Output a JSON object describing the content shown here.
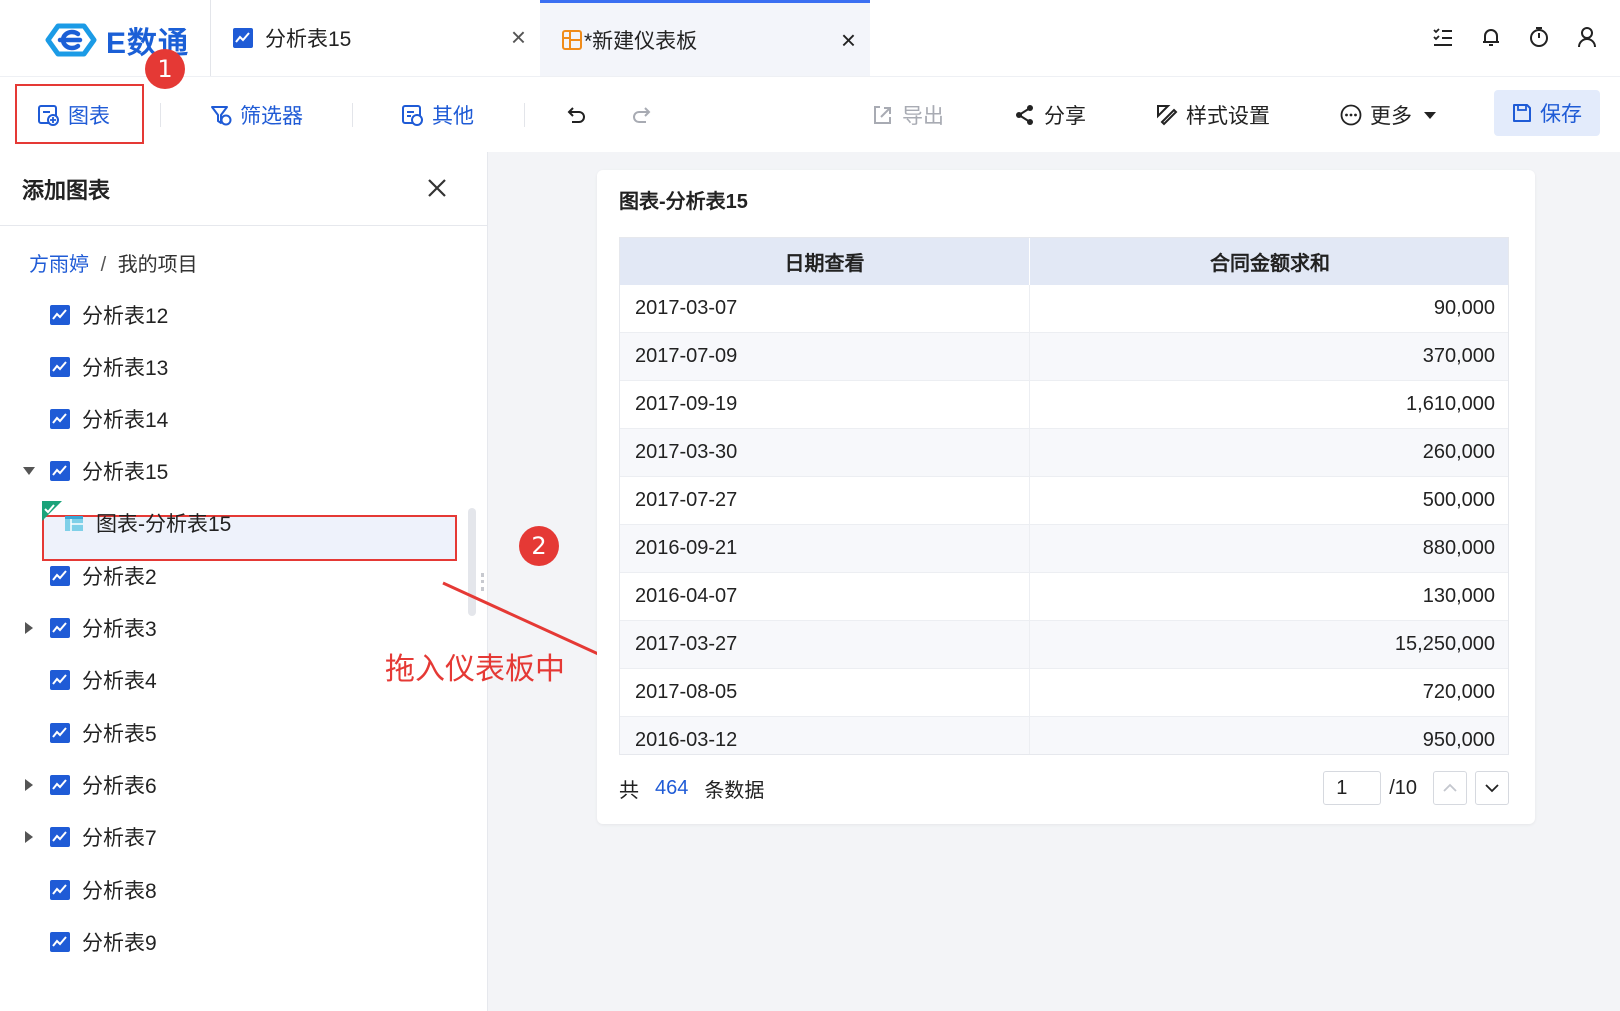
{
  "app": {
    "logo_text": "E数通"
  },
  "tabs": [
    {
      "label": "分析表15",
      "icon": "line-chart-icon",
      "active": false
    },
    {
      "label": "*新建仪表板",
      "icon": "dashboard-icon",
      "active": true
    }
  ],
  "top_icons": [
    "task-list-icon",
    "bell-icon",
    "timer-icon",
    "user-icon"
  ],
  "toolbar": {
    "chart": "图表",
    "filter": "筛选器",
    "other": "其他",
    "export": "导出",
    "share": "分享",
    "style": "样式设置",
    "more": "更多",
    "save": "保存"
  },
  "annotations": {
    "badge1": "1",
    "badge2": "2",
    "drag_hint": "拖入仪表板中"
  },
  "panel": {
    "title": "添加图表",
    "breadcrumb_user": "方雨婷",
    "breadcrumb_sep": "/",
    "breadcrumb_project": "我的项目",
    "items": [
      {
        "label": "分析表12",
        "caret": "none"
      },
      {
        "label": "分析表13",
        "caret": "none"
      },
      {
        "label": "分析表14",
        "caret": "none"
      },
      {
        "label": "分析表15",
        "caret": "down"
      },
      {
        "label": "图表-分析表15",
        "caret": "none",
        "child": true
      },
      {
        "label": "分析表2",
        "caret": "none"
      },
      {
        "label": "分析表3",
        "caret": "right"
      },
      {
        "label": "分析表4",
        "caret": "none"
      },
      {
        "label": "分析表5",
        "caret": "none"
      },
      {
        "label": "分析表6",
        "caret": "right"
      },
      {
        "label": "分析表7",
        "caret": "right"
      },
      {
        "label": "分析表8",
        "caret": "none"
      },
      {
        "label": "分析表9",
        "caret": "none"
      }
    ]
  },
  "card": {
    "title": "图表-分析表15",
    "columns": [
      "日期查看",
      "合同金额求和"
    ],
    "rows": [
      [
        "2017-03-07",
        "90,000"
      ],
      [
        "2017-07-09",
        "370,000"
      ],
      [
        "2017-09-19",
        "1,610,000"
      ],
      [
        "2017-03-30",
        "260,000"
      ],
      [
        "2017-07-27",
        "500,000"
      ],
      [
        "2016-09-21",
        "880,000"
      ],
      [
        "2016-04-07",
        "130,000"
      ],
      [
        "2017-03-27",
        "15,250,000"
      ],
      [
        "2017-08-05",
        "720,000"
      ],
      [
        "2016-03-12",
        "950,000"
      ]
    ],
    "footer": {
      "prefix": "共",
      "count": "464",
      "suffix": "条数据",
      "page": "1",
      "total": "/10"
    }
  },
  "colors": {
    "accent": "#1f5bd6",
    "highlight": "#e53935"
  }
}
